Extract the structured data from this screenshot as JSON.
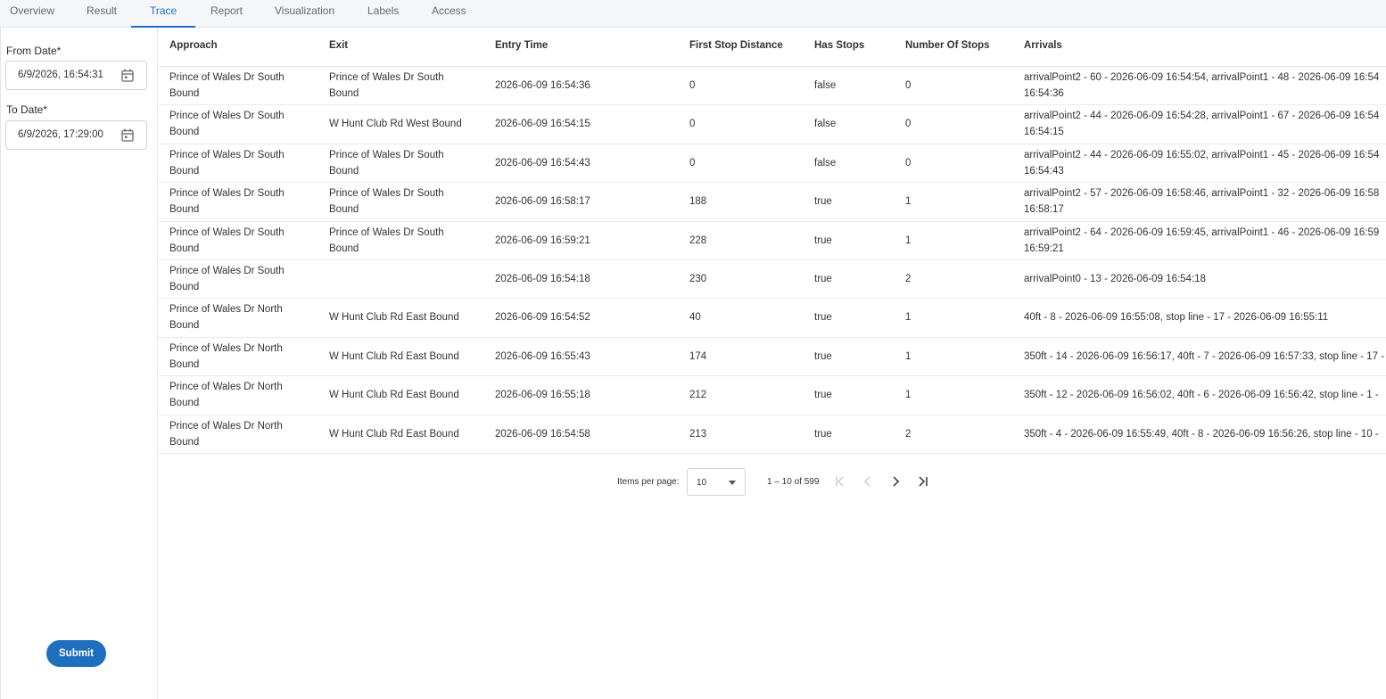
{
  "tabs": [
    {
      "label": "Overview",
      "active": false
    },
    {
      "label": "Result",
      "active": false
    },
    {
      "label": "Trace",
      "active": true
    },
    {
      "label": "Report",
      "active": false
    },
    {
      "label": "Visualization",
      "active": false
    },
    {
      "label": "Labels",
      "active": false
    },
    {
      "label": "Access",
      "active": false
    }
  ],
  "filters": {
    "from_label": "From Date*",
    "from_value": "6/9/2026, 16:54:31",
    "to_label": "To Date*",
    "to_value": "6/9/2026, 17:29:00",
    "submit_label": "Submit"
  },
  "table": {
    "headers": [
      "Approach",
      "Exit",
      "Entry Time",
      "First Stop Distance",
      "Has Stops",
      "Number Of Stops",
      "Arrivals"
    ],
    "rows": [
      {
        "approach": "Prince of Wales Dr South Bound",
        "exit": "Prince of Wales Dr South Bound",
        "entry_time": "2026-06-09 16:54:36",
        "first_stop_distance": "0",
        "has_stops": "false",
        "number_of_stops": "0",
        "arrivals": "arrivalPoint2 - 60 - 2026-06-09 16:54:54, arrivalPoint1 - 48 - 2026-06-09 16:54\n16:54:36"
      },
      {
        "approach": "Prince of Wales Dr South Bound",
        "exit": "W Hunt Club Rd West Bound",
        "entry_time": "2026-06-09 16:54:15",
        "first_stop_distance": "0",
        "has_stops": "false",
        "number_of_stops": "0",
        "arrivals": "arrivalPoint2 - 44 - 2026-06-09 16:54:28, arrivalPoint1 - 67 - 2026-06-09 16:54\n16:54:15"
      },
      {
        "approach": "Prince of Wales Dr South Bound",
        "exit": "Prince of Wales Dr South Bound",
        "entry_time": "2026-06-09 16:54:43",
        "first_stop_distance": "0",
        "has_stops": "false",
        "number_of_stops": "0",
        "arrivals": "arrivalPoint2 - 44 - 2026-06-09 16:55:02, arrivalPoint1 - 45 - 2026-06-09 16:54\n16:54:43"
      },
      {
        "approach": "Prince of Wales Dr South Bound",
        "exit": "Prince of Wales Dr South Bound",
        "entry_time": "2026-06-09 16:58:17",
        "first_stop_distance": "188",
        "has_stops": "true",
        "number_of_stops": "1",
        "arrivals": "arrivalPoint2 - 57 - 2026-06-09 16:58:46, arrivalPoint1 - 32 - 2026-06-09 16:58\n16:58:17"
      },
      {
        "approach": "Prince of Wales Dr South Bound",
        "exit": "Prince of Wales Dr South Bound",
        "entry_time": "2026-06-09 16:59:21",
        "first_stop_distance": "228",
        "has_stops": "true",
        "number_of_stops": "1",
        "arrivals": "arrivalPoint2 - 64 - 2026-06-09 16:59:45, arrivalPoint1 - 46 - 2026-06-09 16:59\n16:59:21"
      },
      {
        "approach": "Prince of Wales Dr South Bound",
        "exit": "",
        "entry_time": "2026-06-09 16:54:18",
        "first_stop_distance": "230",
        "has_stops": "true",
        "number_of_stops": "2",
        "arrivals": "arrivalPoint0 - 13 - 2026-06-09 16:54:18"
      },
      {
        "approach": "Prince of Wales Dr North Bound",
        "exit": "W Hunt Club Rd East Bound",
        "entry_time": "2026-06-09 16:54:52",
        "first_stop_distance": "40",
        "has_stops": "true",
        "number_of_stops": "1",
        "arrivals": "40ft - 8 - 2026-06-09 16:55:08, stop line - 17 - 2026-06-09 16:55:11"
      },
      {
        "approach": "Prince of Wales Dr North Bound",
        "exit": "W Hunt Club Rd East Bound",
        "entry_time": "2026-06-09 16:55:43",
        "first_stop_distance": "174",
        "has_stops": "true",
        "number_of_stops": "1",
        "arrivals": "350ft - 14 - 2026-06-09 16:56:17, 40ft - 7 - 2026-06-09 16:57:33, stop line - 17 -"
      },
      {
        "approach": "Prince of Wales Dr North Bound",
        "exit": "W Hunt Club Rd East Bound",
        "entry_time": "2026-06-09 16:55:18",
        "first_stop_distance": "212",
        "has_stops": "true",
        "number_of_stops": "1",
        "arrivals": "350ft - 12 - 2026-06-09 16:56:02, 40ft - 6 - 2026-06-09 16:56:42, stop line - 1 -"
      },
      {
        "approach": "Prince of Wales Dr North Bound",
        "exit": "W Hunt Club Rd East Bound",
        "entry_time": "2026-06-09 16:54:58",
        "first_stop_distance": "213",
        "has_stops": "true",
        "number_of_stops": "2",
        "arrivals": "350ft - 4 - 2026-06-09 16:55:49, 40ft - 8 - 2026-06-09 16:56:26, stop line - 10 -"
      }
    ]
  },
  "pagination": {
    "items_per_page_label": "Items per page:",
    "items_per_page_value": "10",
    "range_label": "1 – 10 of 599"
  }
}
